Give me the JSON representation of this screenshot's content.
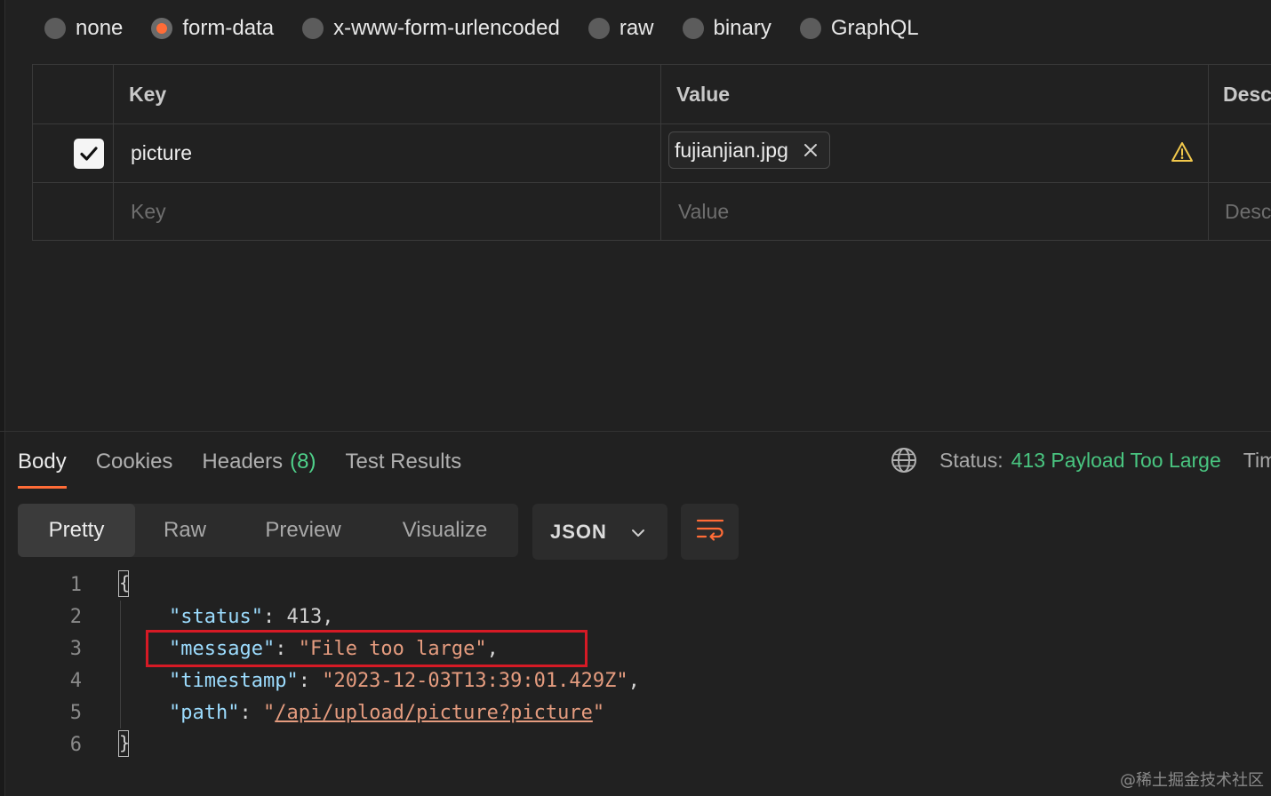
{
  "body_types": {
    "options": [
      "none",
      "form-data",
      "x-www-form-urlencoded",
      "raw",
      "binary",
      "GraphQL"
    ],
    "selected": "form-data"
  },
  "form_table": {
    "headers": {
      "key": "Key",
      "value": "Value",
      "description": "Desc"
    },
    "rows": [
      {
        "checked": true,
        "key": "picture",
        "file": "fujianjian.jpg",
        "warning": true
      }
    ],
    "placeholder": {
      "key": "Key",
      "value": "Value",
      "description": "Desc"
    }
  },
  "response": {
    "tabs": [
      {
        "label": "Body"
      },
      {
        "label": "Cookies"
      },
      {
        "label": "Headers",
        "count": "(8)"
      },
      {
        "label": "Test Results"
      }
    ],
    "active_tab": "Body",
    "status_label": "Status:",
    "status_value": "413 Payload Too Large",
    "time_label": "Tim"
  },
  "view_modes": {
    "options": [
      "Pretty",
      "Raw",
      "Preview",
      "Visualize"
    ],
    "active": "Pretty"
  },
  "format": "JSON",
  "code_lines": {
    "numbers": [
      "1",
      "2",
      "3",
      "4",
      "5",
      "6"
    ],
    "open_brace": "{",
    "close_brace": "}",
    "status_key": "\"status\"",
    "status_value": "413",
    "message_key": "\"message\"",
    "message_value": "\"File too large\"",
    "timestamp_key": "\"timestamp\"",
    "timestamp_value": "\"2023-12-03T13:39:01.429Z\"",
    "path_key": "\"path\"",
    "path_value": "/api/upload/picture?picture"
  },
  "colors": {
    "accent": "#ff6c37",
    "status_ok_text": "#49c580",
    "highlight": "#d61a25"
  },
  "watermark": "@稀土掘金技术社区"
}
